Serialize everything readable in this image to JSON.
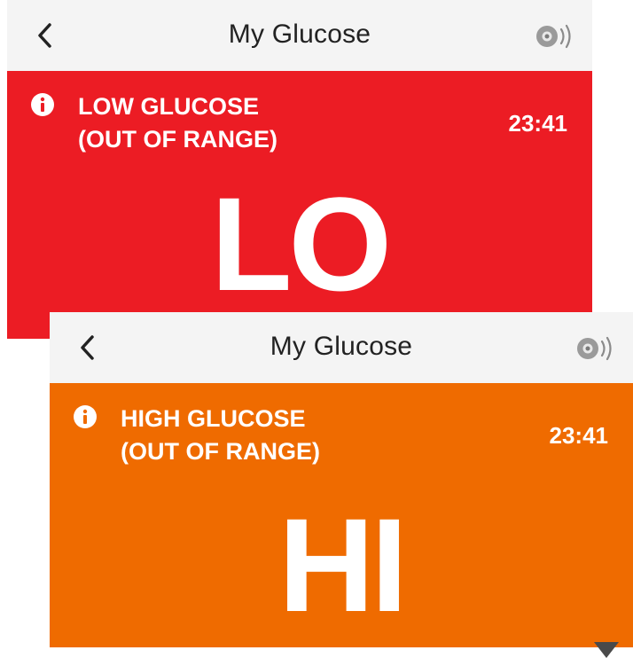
{
  "colors": {
    "low_alert": "#ec1c24",
    "high_alert": "#ef6b00",
    "header_bg": "#f4f4f4",
    "text_on_alert": "#ffffff"
  },
  "screens": [
    {
      "header": {
        "back_icon": "chevron-left-icon",
        "title": "My Glucose",
        "sound_icon": "speaker-icon"
      },
      "alert": {
        "icon": "info-icon",
        "label_line1": "LOW GLUCOSE",
        "label_line2": "(OUT OF RANGE)",
        "time": "23:41",
        "reading": "LO"
      }
    },
    {
      "header": {
        "back_icon": "chevron-left-icon",
        "title": "My Glucose",
        "sound_icon": "speaker-icon"
      },
      "alert": {
        "icon": "info-icon",
        "label_line1": "HIGH GLUCOSE",
        "label_line2": "(OUT OF RANGE)",
        "time": "23:41",
        "reading": "HI"
      }
    }
  ]
}
